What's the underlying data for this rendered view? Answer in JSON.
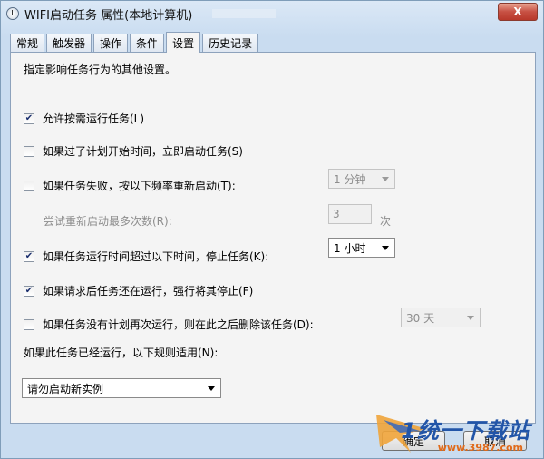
{
  "window": {
    "title": "WIFI启动任务 属性(本地计算机)",
    "close_label": "X"
  },
  "tabs": [
    {
      "label": "常规",
      "active": false
    },
    {
      "label": "触发器",
      "active": false
    },
    {
      "label": "操作",
      "active": false
    },
    {
      "label": "条件",
      "active": false
    },
    {
      "label": "设置",
      "active": true
    },
    {
      "label": "历史记录",
      "active": false
    }
  ],
  "settings": {
    "description": "指定影响任务行为的其他设置。",
    "allow_on_demand": {
      "label": "允许按需运行任务(L)",
      "checked": true
    },
    "run_if_missed": {
      "label": "如果过了计划开始时间，立即启动任务(S)",
      "checked": false
    },
    "restart_on_fail": {
      "label": "如果任务失败，按以下频率重新启动(T):",
      "checked": false,
      "interval": "1 分钟"
    },
    "restart_attempts": {
      "label": "尝试重新启动最多次数(R):",
      "value": "3",
      "unit": "次"
    },
    "stop_if_runs_longer": {
      "label": "如果任务运行时间超过以下时间，停止任务(K):",
      "checked": true,
      "duration": "1 小时"
    },
    "force_stop": {
      "label": "如果请求后任务还在运行，强行将其停止(F)",
      "checked": true
    },
    "delete_if_not_scheduled": {
      "label": "如果任务没有计划再次运行，则在此之后删除该任务(D):",
      "checked": false,
      "after": "30 天"
    },
    "running_rule": {
      "label": "如果此任务已经运行，以下规则适用(N):",
      "value": "请勿启动新实例"
    }
  },
  "buttons": {
    "ok_label": "确定",
    "cancel_label": "取消"
  },
  "watermark": {
    "text": "1统一下载站",
    "url": "www.3987.com"
  },
  "colors": {
    "window_frame": "#c9dcf0",
    "panel": "#f4f4f4",
    "close_button": "#c75043"
  }
}
